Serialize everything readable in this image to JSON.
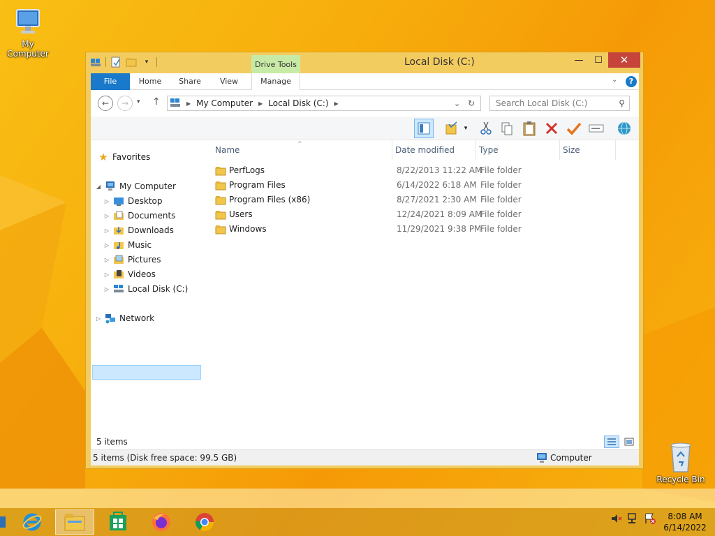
{
  "desktop": {
    "icons": [
      {
        "label": "My Computer"
      },
      {
        "label": "Recycle Bin"
      }
    ]
  },
  "window": {
    "title": "Local Disk (C:)",
    "context_tab_group": "Drive Tools",
    "ribbon_tabs": [
      "File",
      "Home",
      "Share",
      "View",
      "Manage"
    ],
    "address": {
      "segments": [
        "My Computer",
        "Local Disk (C:)"
      ]
    },
    "search": {
      "placeholder": "Search Local Disk (C:)"
    },
    "nav": {
      "favorites": "Favorites",
      "my_computer": "My Computer",
      "children": [
        "Desktop",
        "Documents",
        "Downloads",
        "Music",
        "Pictures",
        "Videos",
        "Local Disk (C:)"
      ],
      "network": "Network"
    },
    "columns": [
      "Name",
      "Date modified",
      "Type",
      "Size"
    ],
    "files": [
      {
        "name": "PerfLogs",
        "date": "8/22/2013 11:22 AM",
        "type": "File folder"
      },
      {
        "name": "Program Files",
        "date": "6/14/2022 6:18 AM",
        "type": "File folder"
      },
      {
        "name": "Program Files (x86)",
        "date": "8/27/2021 2:30 AM",
        "type": "File folder"
      },
      {
        "name": "Users",
        "date": "12/24/2021 8:09 AM",
        "type": "File folder"
      },
      {
        "name": "Windows",
        "date": "11/29/2021 9:38 PM",
        "type": "File folder"
      }
    ],
    "item_count": "5 items",
    "status_left": "5 items (Disk free space: 99.5 GB)",
    "status_right": "Computer"
  },
  "taskbar": {
    "time": "8:08 AM",
    "date": "6/14/2022"
  }
}
